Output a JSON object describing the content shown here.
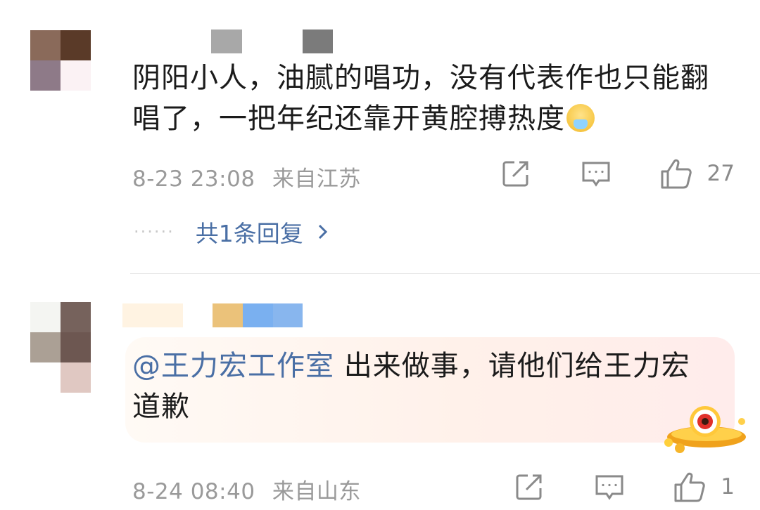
{
  "comments": [
    {
      "text": "阴阳小人，油腻的唱功，没有代表作也只能翻唱了，一把年纪还靠开黄腔搏热度",
      "emoji": "vomiting-face-icon",
      "timestamp": "8-23 23:08",
      "location": "来自江苏",
      "likes": "27",
      "replies_label": "共1条回复",
      "avatar_colors": [
        "#8a6a5a",
        "#5a3a28",
        "#8e7a88",
        "#fbf2f4"
      ],
      "name_colors": [
        "#a8a8a8",
        "#7b7b7b"
      ]
    },
    {
      "mention": "@王力宏工作室",
      "text": "出来做事，请他们给王力宏道歉",
      "timestamp": "8-24 08:40",
      "location": "来自山东",
      "likes": "1",
      "sticker": "golden-ufo-sticker",
      "avatar_colors": [
        "#f4f5f2",
        "#76625c",
        "#aba095",
        "#6d5751",
        "#ffffff",
        "#e0c8c2"
      ],
      "name_colors": [
        "#fff3e2",
        "#ebc27a",
        "#7ab0f0",
        "#88b6ee"
      ]
    }
  ],
  "colors": {
    "link": "#4a6fa5",
    "meta": "#9a9a9a",
    "divider": "#e6e6e6"
  }
}
